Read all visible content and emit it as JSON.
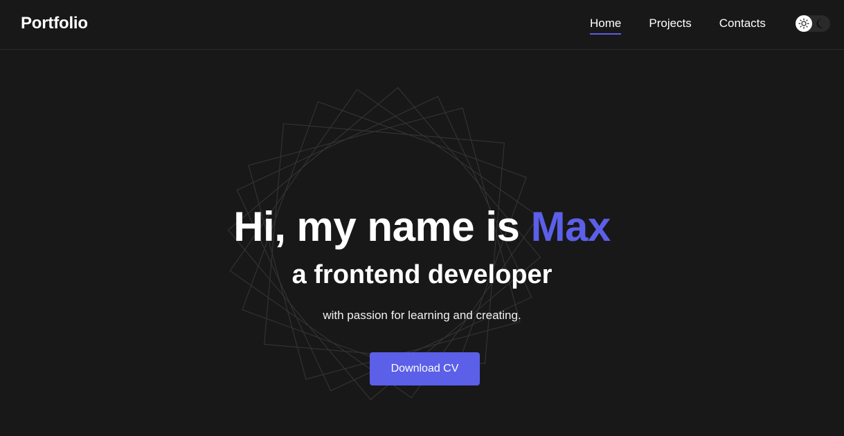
{
  "header": {
    "logo": "Portfolio",
    "nav": [
      {
        "label": "Home",
        "active": true
      },
      {
        "label": "Projects",
        "active": false
      },
      {
        "label": "Contacts",
        "active": false
      }
    ],
    "theme_toggle": {
      "icons": [
        "sun-icon",
        "moon-icon"
      ],
      "mode": "dark"
    }
  },
  "hero": {
    "title_prefix": "Hi, my name is",
    "title_name": "Max",
    "subtitle": "a frontend developer",
    "tagline": "with passion for learning and creating.",
    "cta_label": "Download CV"
  },
  "colors": {
    "background": "#181818",
    "accent": "#5c5fe8",
    "text": "#ffffff"
  }
}
